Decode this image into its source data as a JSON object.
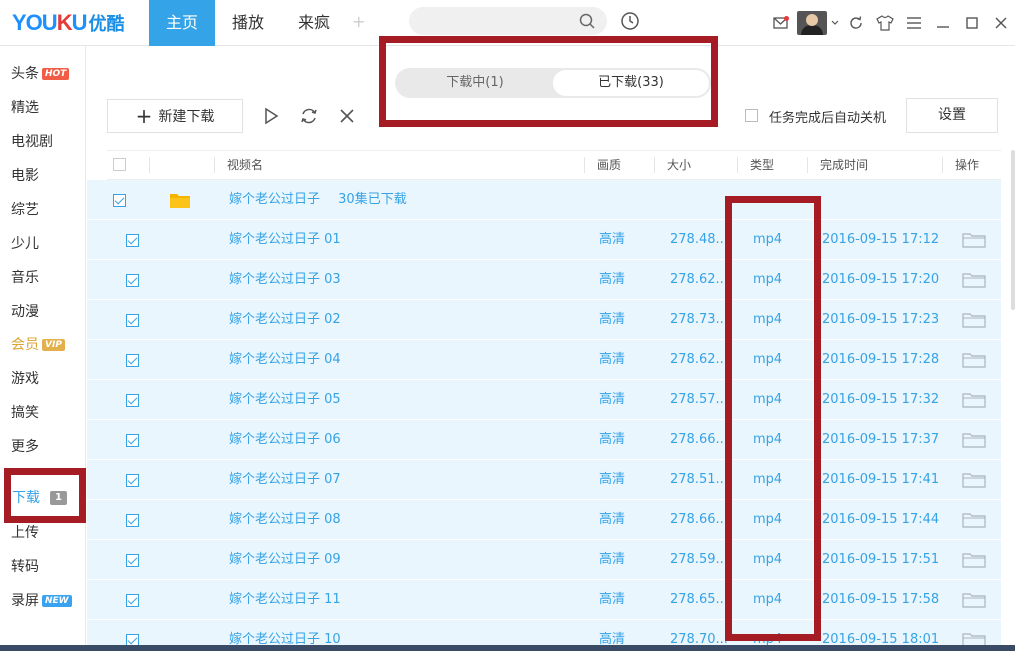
{
  "logo": {
    "latin": "YOUKU",
    "cn": "优酷"
  },
  "nav": [
    {
      "label": "主页",
      "active": true
    },
    {
      "label": "播放",
      "active": false
    },
    {
      "label": "来疯",
      "active": false
    }
  ],
  "nav_plus": "+",
  "search": {
    "placeholder": ""
  },
  "sidebar": [
    {
      "label": "头条",
      "badge": "HOT",
      "badge_type": "hot"
    },
    {
      "label": "精选"
    },
    {
      "label": "电视剧"
    },
    {
      "label": "电影"
    },
    {
      "label": "综艺"
    },
    {
      "label": "少儿"
    },
    {
      "label": "音乐"
    },
    {
      "label": "动漫"
    },
    {
      "label": "会员",
      "badge": "VIP",
      "badge_type": "vip"
    },
    {
      "label": "游戏"
    },
    {
      "label": "搞笑"
    },
    {
      "label": "更多"
    },
    {
      "label": "下载",
      "badge": "1",
      "badge_type": "count",
      "active": true
    },
    {
      "label": "上传"
    },
    {
      "label": "转码"
    },
    {
      "label": "录屏",
      "badge": "NEW",
      "badge_type": "new"
    }
  ],
  "segmented": {
    "downloading": "下载中(1)",
    "downloaded": "已下载(33)"
  },
  "toolbar": {
    "new_download": "新建下载",
    "auto_shutdown": "任务完成后自动关机",
    "settings": "设置"
  },
  "columns": {
    "name": "视频名",
    "quality": "画质",
    "size": "大小",
    "type": "类型",
    "finish_time": "完成时间",
    "action": "操作"
  },
  "group": {
    "title": "嫁个老公过日子",
    "summary": "30集已下载"
  },
  "rows": [
    {
      "name": "嫁个老公过日子 01",
      "quality": "高清",
      "size": "278.48...",
      "type": "mp4",
      "time": "2016-09-15 17:12"
    },
    {
      "name": "嫁个老公过日子 03",
      "quality": "高清",
      "size": "278.62...",
      "type": "mp4",
      "time": "2016-09-15 17:20"
    },
    {
      "name": "嫁个老公过日子 02",
      "quality": "高清",
      "size": "278.73...",
      "type": "mp4",
      "time": "2016-09-15 17:23"
    },
    {
      "name": "嫁个老公过日子 04",
      "quality": "高清",
      "size": "278.62...",
      "type": "mp4",
      "time": "2016-09-15 17:28"
    },
    {
      "name": "嫁个老公过日子 05",
      "quality": "高清",
      "size": "278.57...",
      "type": "mp4",
      "time": "2016-09-15 17:32"
    },
    {
      "name": "嫁个老公过日子 06",
      "quality": "高清",
      "size": "278.66...",
      "type": "mp4",
      "time": "2016-09-15 17:37"
    },
    {
      "name": "嫁个老公过日子 07",
      "quality": "高清",
      "size": "278.51...",
      "type": "mp4",
      "time": "2016-09-15 17:41"
    },
    {
      "name": "嫁个老公过日子 08",
      "quality": "高清",
      "size": "278.66...",
      "type": "mp4",
      "time": "2016-09-15 17:44"
    },
    {
      "name": "嫁个老公过日子 09",
      "quality": "高清",
      "size": "278.59...",
      "type": "mp4",
      "time": "2016-09-15 17:51"
    },
    {
      "name": "嫁个老公过日子 11",
      "quality": "高清",
      "size": "278.65...",
      "type": "mp4",
      "time": "2016-09-15 17:58"
    },
    {
      "name": "嫁个老公过日子 10",
      "quality": "高清",
      "size": "278.70...",
      "type": "mp4",
      "time": "2016-09-15 18:01"
    }
  ],
  "colors": {
    "accent": "#35a3e7",
    "row_bg": "#eaf6fd",
    "annotation": "#a61c24"
  }
}
